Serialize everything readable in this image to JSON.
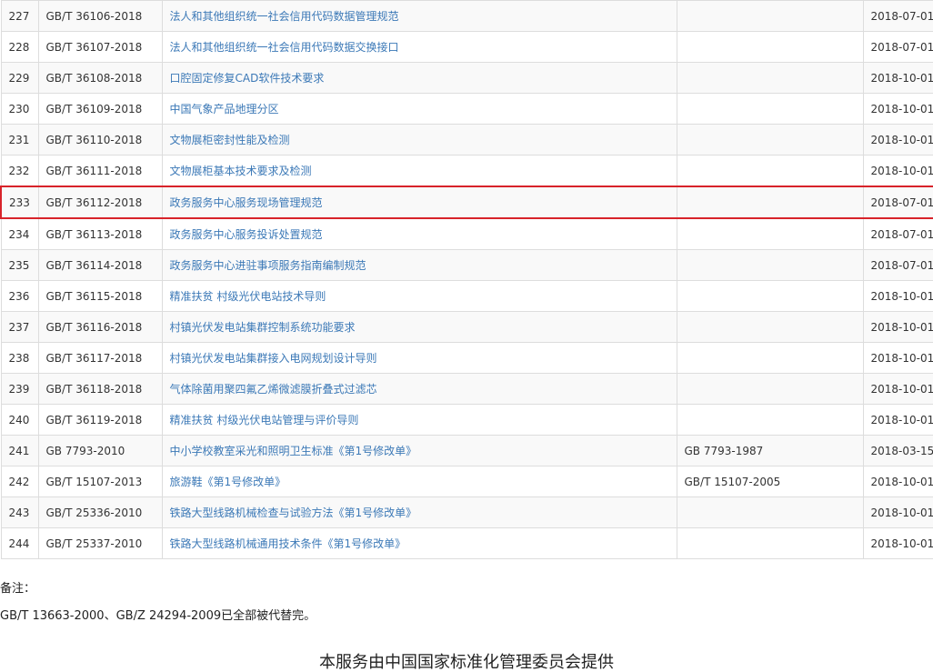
{
  "table": {
    "rows": [
      {
        "num": "227",
        "code": "GB/T 36106-2018",
        "name": "法人和其他组织统一社会信用代码数据管理规范",
        "replaced": "",
        "date": "2018-07-01"
      },
      {
        "num": "228",
        "code": "GB/T 36107-2018",
        "name": "法人和其他组织统一社会信用代码数据交换接口",
        "replaced": "",
        "date": "2018-07-01"
      },
      {
        "num": "229",
        "code": "GB/T 36108-2018",
        "name": "口腔固定修复CAD软件技术要求",
        "replaced": "",
        "date": "2018-10-01"
      },
      {
        "num": "230",
        "code": "GB/T 36109-2018",
        "name": "中国气象产品地理分区",
        "replaced": "",
        "date": "2018-10-01"
      },
      {
        "num": "231",
        "code": "GB/T 36110-2018",
        "name": "文物展柜密封性能及检测",
        "replaced": "",
        "date": "2018-10-01"
      },
      {
        "num": "232",
        "code": "GB/T 36111-2018",
        "name": "文物展柜基本技术要求及检测",
        "replaced": "",
        "date": "2018-10-01"
      },
      {
        "num": "233",
        "code": "GB/T 36112-2018",
        "name": "政务服务中心服务现场管理规范",
        "replaced": "",
        "date": "2018-07-01"
      },
      {
        "num": "234",
        "code": "GB/T 36113-2018",
        "name": "政务服务中心服务投诉处置规范",
        "replaced": "",
        "date": "2018-07-01"
      },
      {
        "num": "235",
        "code": "GB/T 36114-2018",
        "name": "政务服务中心进驻事项服务指南编制规范",
        "replaced": "",
        "date": "2018-07-01"
      },
      {
        "num": "236",
        "code": "GB/T 36115-2018",
        "name": "精准扶贫 村级光伏电站技术导则",
        "replaced": "",
        "date": "2018-10-01"
      },
      {
        "num": "237",
        "code": "GB/T 36116-2018",
        "name": "村镇光伏发电站集群控制系统功能要求",
        "replaced": "",
        "date": "2018-10-01"
      },
      {
        "num": "238",
        "code": "GB/T 36117-2018",
        "name": "村镇光伏发电站集群接入电网规划设计导则",
        "replaced": "",
        "date": "2018-10-01"
      },
      {
        "num": "239",
        "code": "GB/T 36118-2018",
        "name": "气体除菌用聚四氟乙烯微滤膜折叠式过滤芯",
        "replaced": "",
        "date": "2018-10-01"
      },
      {
        "num": "240",
        "code": "GB/T 36119-2018",
        "name": "精准扶贫 村级光伏电站管理与评价导则",
        "replaced": "",
        "date": "2018-10-01"
      },
      {
        "num": "241",
        "code": "GB 7793-2010",
        "name": "中小学校教室采光和照明卫生标准《第1号修改单》",
        "replaced": "GB 7793-1987",
        "date": "2018-03-15"
      },
      {
        "num": "242",
        "code": "GB/T 15107-2013",
        "name": "旅游鞋《第1号修改单》",
        "replaced": "GB/T 15107-2005",
        "date": "2018-10-01"
      },
      {
        "num": "243",
        "code": "GB/T 25336-2010",
        "name": "铁路大型线路机械检查与试验方法《第1号修改单》",
        "replaced": "",
        "date": "2018-10-01"
      },
      {
        "num": "244",
        "code": "GB/T 25337-2010",
        "name": "铁路大型线路机械通用技术条件《第1号修改单》",
        "replaced": "",
        "date": "2018-10-01"
      }
    ],
    "highlighted_row_num": "233"
  },
  "notes": {
    "label": "备注：",
    "text": "GB/T 13663-2000、GB/Z 24294-2009已全部被代替完。"
  },
  "footer": {
    "text": "本服务由中国国家标准化管理委员会提供"
  },
  "colors": {
    "link": "#3c79b7",
    "highlight_border": "#d8232a",
    "row_alt": "#f9f9f9",
    "border": "#dddddd"
  }
}
